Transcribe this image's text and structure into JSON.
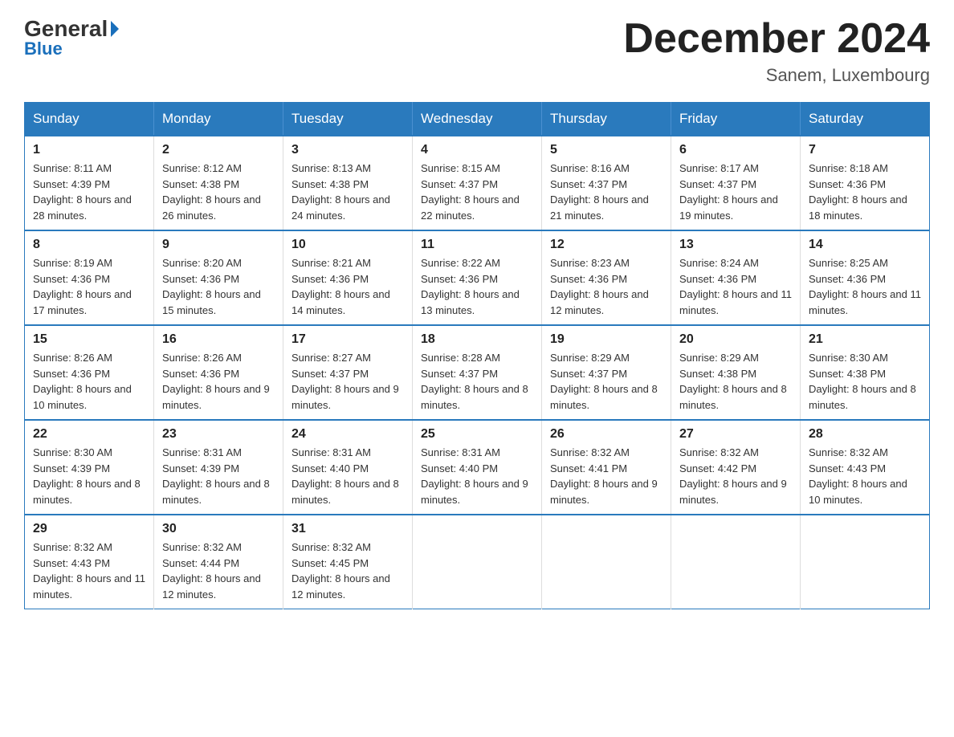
{
  "logo": {
    "general": "General",
    "blue": "Blue"
  },
  "title": "December 2024",
  "location": "Sanem, Luxembourg",
  "days_of_week": [
    "Sunday",
    "Monday",
    "Tuesday",
    "Wednesday",
    "Thursday",
    "Friday",
    "Saturday"
  ],
  "weeks": [
    [
      {
        "day": "1",
        "sunrise": "8:11 AM",
        "sunset": "4:39 PM",
        "daylight": "8 hours and 28 minutes."
      },
      {
        "day": "2",
        "sunrise": "8:12 AM",
        "sunset": "4:38 PM",
        "daylight": "8 hours and 26 minutes."
      },
      {
        "day": "3",
        "sunrise": "8:13 AM",
        "sunset": "4:38 PM",
        "daylight": "8 hours and 24 minutes."
      },
      {
        "day": "4",
        "sunrise": "8:15 AM",
        "sunset": "4:37 PM",
        "daylight": "8 hours and 22 minutes."
      },
      {
        "day": "5",
        "sunrise": "8:16 AM",
        "sunset": "4:37 PM",
        "daylight": "8 hours and 21 minutes."
      },
      {
        "day": "6",
        "sunrise": "8:17 AM",
        "sunset": "4:37 PM",
        "daylight": "8 hours and 19 minutes."
      },
      {
        "day": "7",
        "sunrise": "8:18 AM",
        "sunset": "4:36 PM",
        "daylight": "8 hours and 18 minutes."
      }
    ],
    [
      {
        "day": "8",
        "sunrise": "8:19 AM",
        "sunset": "4:36 PM",
        "daylight": "8 hours and 17 minutes."
      },
      {
        "day": "9",
        "sunrise": "8:20 AM",
        "sunset": "4:36 PM",
        "daylight": "8 hours and 15 minutes."
      },
      {
        "day": "10",
        "sunrise": "8:21 AM",
        "sunset": "4:36 PM",
        "daylight": "8 hours and 14 minutes."
      },
      {
        "day": "11",
        "sunrise": "8:22 AM",
        "sunset": "4:36 PM",
        "daylight": "8 hours and 13 minutes."
      },
      {
        "day": "12",
        "sunrise": "8:23 AM",
        "sunset": "4:36 PM",
        "daylight": "8 hours and 12 minutes."
      },
      {
        "day": "13",
        "sunrise": "8:24 AM",
        "sunset": "4:36 PM",
        "daylight": "8 hours and 11 minutes."
      },
      {
        "day": "14",
        "sunrise": "8:25 AM",
        "sunset": "4:36 PM",
        "daylight": "8 hours and 11 minutes."
      }
    ],
    [
      {
        "day": "15",
        "sunrise": "8:26 AM",
        "sunset": "4:36 PM",
        "daylight": "8 hours and 10 minutes."
      },
      {
        "day": "16",
        "sunrise": "8:26 AM",
        "sunset": "4:36 PM",
        "daylight": "8 hours and 9 minutes."
      },
      {
        "day": "17",
        "sunrise": "8:27 AM",
        "sunset": "4:37 PM",
        "daylight": "8 hours and 9 minutes."
      },
      {
        "day": "18",
        "sunrise": "8:28 AM",
        "sunset": "4:37 PM",
        "daylight": "8 hours and 8 minutes."
      },
      {
        "day": "19",
        "sunrise": "8:29 AM",
        "sunset": "4:37 PM",
        "daylight": "8 hours and 8 minutes."
      },
      {
        "day": "20",
        "sunrise": "8:29 AM",
        "sunset": "4:38 PM",
        "daylight": "8 hours and 8 minutes."
      },
      {
        "day": "21",
        "sunrise": "8:30 AM",
        "sunset": "4:38 PM",
        "daylight": "8 hours and 8 minutes."
      }
    ],
    [
      {
        "day": "22",
        "sunrise": "8:30 AM",
        "sunset": "4:39 PM",
        "daylight": "8 hours and 8 minutes."
      },
      {
        "day": "23",
        "sunrise": "8:31 AM",
        "sunset": "4:39 PM",
        "daylight": "8 hours and 8 minutes."
      },
      {
        "day": "24",
        "sunrise": "8:31 AM",
        "sunset": "4:40 PM",
        "daylight": "8 hours and 8 minutes."
      },
      {
        "day": "25",
        "sunrise": "8:31 AM",
        "sunset": "4:40 PM",
        "daylight": "8 hours and 9 minutes."
      },
      {
        "day": "26",
        "sunrise": "8:32 AM",
        "sunset": "4:41 PM",
        "daylight": "8 hours and 9 minutes."
      },
      {
        "day": "27",
        "sunrise": "8:32 AM",
        "sunset": "4:42 PM",
        "daylight": "8 hours and 9 minutes."
      },
      {
        "day": "28",
        "sunrise": "8:32 AM",
        "sunset": "4:43 PM",
        "daylight": "8 hours and 10 minutes."
      }
    ],
    [
      {
        "day": "29",
        "sunrise": "8:32 AM",
        "sunset": "4:43 PM",
        "daylight": "8 hours and 11 minutes."
      },
      {
        "day": "30",
        "sunrise": "8:32 AM",
        "sunset": "4:44 PM",
        "daylight": "8 hours and 12 minutes."
      },
      {
        "day": "31",
        "sunrise": "8:32 AM",
        "sunset": "4:45 PM",
        "daylight": "8 hours and 12 minutes."
      },
      null,
      null,
      null,
      null
    ]
  ],
  "labels": {
    "sunrise": "Sunrise:",
    "sunset": "Sunset:",
    "daylight": "Daylight:"
  }
}
